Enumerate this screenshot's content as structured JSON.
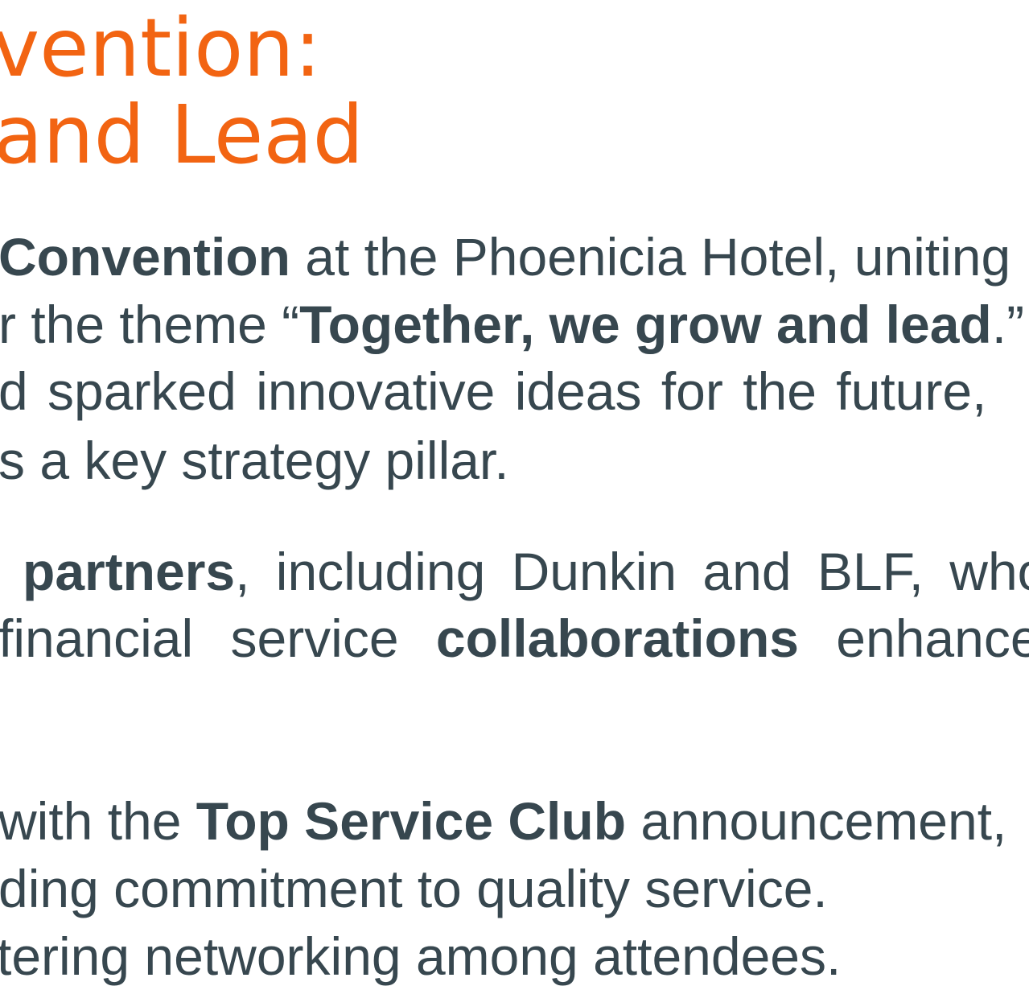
{
  "colors": {
    "heading": "#f26412",
    "body_text": "#37474f",
    "background": "#ffffff"
  },
  "heading": {
    "line1": "vention:",
    "line2": "and Lead"
  },
  "paragraph1": {
    "line1_bold": "Convention",
    "line1_rest": " at the Phoenicia Hotel, uniting",
    "line2_pre": "r the theme “",
    "line2_bold": "Together, we grow and lead",
    "line2_post": ".”",
    "line3": "d sparked innovative ideas for the future,",
    "line4": "s a key strategy pillar."
  },
  "paragraph2": {
    "line1_bold": "partners",
    "line1_rest": ", including Dunkin and BLF, who",
    "line2_pre": "financial service ",
    "line2_bold": "collaborations",
    "line2_post": " enhance"
  },
  "paragraph3": {
    "line1_pre": "with the ",
    "line1_bold": "Top Service Club",
    "line1_post": " announcement,",
    "line2": "ding commitment to quality service.",
    "line3": "tering networking among attendees."
  }
}
